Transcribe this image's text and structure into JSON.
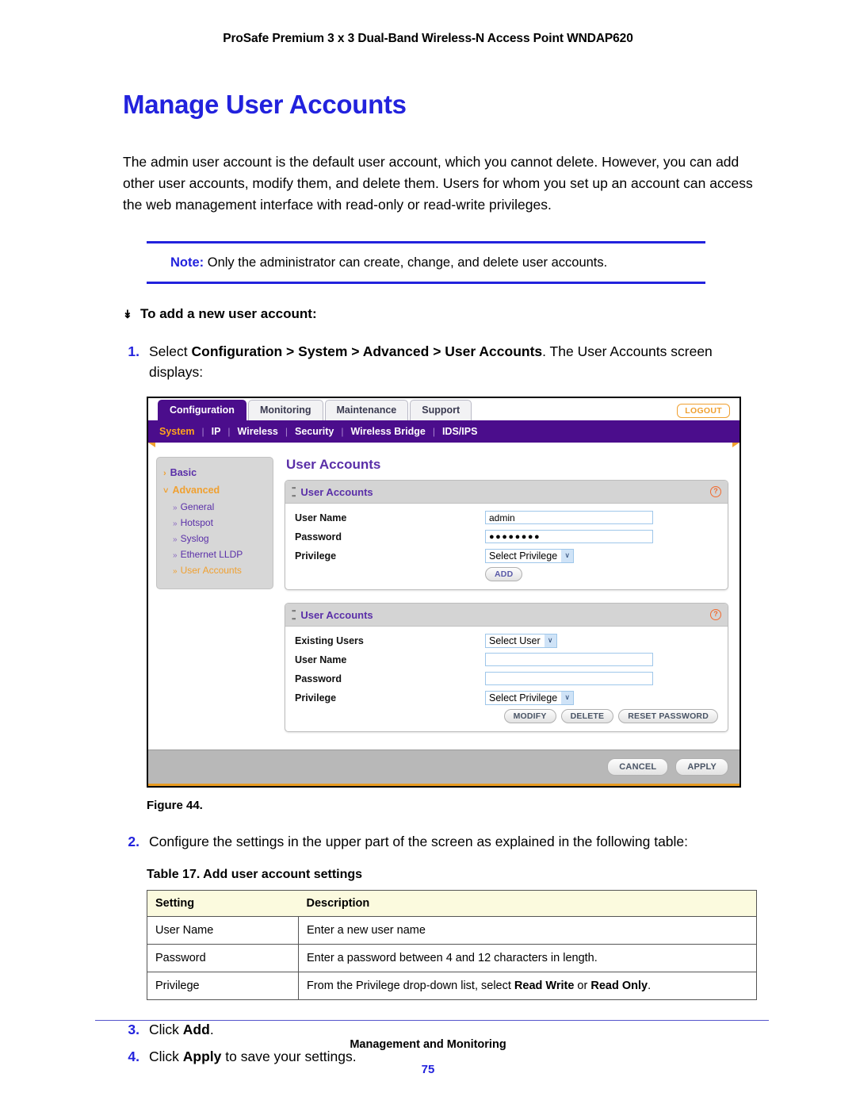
{
  "page_header": "ProSafe Premium 3 x 3 Dual-Band Wireless-N Access Point WNDAP620",
  "title": "Manage User Accounts",
  "intro": "The admin user account is the default user account, which you cannot delete. However, you can add other user accounts, modify them, and delete them. Users for whom you set up an account can access the web management interface with read-only or read-write privileges.",
  "note": {
    "label": "Note:",
    "text": " Only the administrator can create, change, and delete user accounts."
  },
  "procedure": {
    "marker": "↡",
    "heading": "To add a new user account:"
  },
  "steps": {
    "s1": {
      "num": "1.",
      "pre": "Select ",
      "bold": "Configuration > System > Advanced > User Accounts",
      "post": ". The User Accounts screen displays:"
    },
    "s2": {
      "num": "2.",
      "text": "Configure the settings in the upper part of the screen as explained in the following table:"
    },
    "s3": {
      "num": "3.",
      "pre": "Click ",
      "bold": "Add",
      "post": "."
    },
    "s4": {
      "num": "4.",
      "pre": "Click ",
      "bold": "Apply",
      "post": " to save your settings."
    }
  },
  "screenshot": {
    "tabs": [
      {
        "label": "Configuration",
        "active": true
      },
      {
        "label": "Monitoring",
        "active": false
      },
      {
        "label": "Maintenance",
        "active": false
      },
      {
        "label": "Support",
        "active": false
      }
    ],
    "logout_label": "LOGOUT",
    "subnav": [
      {
        "label": "System",
        "active": true
      },
      {
        "label": "IP",
        "active": false
      },
      {
        "label": "Wireless",
        "active": false
      },
      {
        "label": "Security",
        "active": false
      },
      {
        "label": "Wireless Bridge",
        "active": false
      },
      {
        "label": "IDS/IPS",
        "active": false
      }
    ],
    "sidebar": {
      "basic": {
        "label": "Basic",
        "arrow": "›"
      },
      "advanced": {
        "label": "Advanced",
        "arrow": "˅"
      },
      "sub_items": [
        {
          "label": "General",
          "active": false
        },
        {
          "label": "Hotspot",
          "active": false
        },
        {
          "label": "Syslog",
          "active": false
        },
        {
          "label": "Ethernet LLDP",
          "active": false
        },
        {
          "label": "User Accounts",
          "active": true
        }
      ],
      "sub_arrow": "»"
    },
    "page_title": "User Accounts",
    "help_glyph": "?",
    "panel_add": {
      "title": "User Accounts",
      "rows": {
        "user_name_label": "User Name",
        "user_name_value": "admin",
        "password_label": "Password",
        "password_value": "●●●●●●●●",
        "privilege_label": "Privilege",
        "privilege_value": "Select Privilege"
      },
      "add_button": "ADD"
    },
    "panel_modify": {
      "title": "User Accounts",
      "rows": {
        "existing_users_label": "Existing Users",
        "existing_users_value": "Select User",
        "user_name_label": "User Name",
        "user_name_value": "",
        "password_label": "Password",
        "password_value": "",
        "privilege_label": "Privilege",
        "privilege_value": "Select Privilege"
      },
      "buttons": [
        "MODIFY",
        "DELETE",
        "RESET PASSWORD"
      ]
    },
    "footer_buttons": [
      "CANCEL",
      "APPLY"
    ],
    "dropdown_arrow": "∨"
  },
  "figure_caption": "Figure 44.",
  "table": {
    "caption": "Table 17.  Add user account settings",
    "headers": [
      "Setting",
      "Description"
    ],
    "rows": [
      {
        "setting": "User Name",
        "desc_pre": "Enter a new user name",
        "desc_b1": "",
        "desc_mid": "",
        "desc_b2": "",
        "desc_post": ""
      },
      {
        "setting": "Password",
        "desc_pre": "Enter a password between 4 and 12 characters in length.",
        "desc_b1": "",
        "desc_mid": "",
        "desc_b2": "",
        "desc_post": ""
      },
      {
        "setting": "Privilege",
        "desc_pre": "From the Privilege drop-down list, select ",
        "desc_b1": "Read Write",
        "desc_mid": " or ",
        "desc_b2": "Read Only",
        "desc_post": "."
      }
    ]
  },
  "footer": {
    "title": "Management and Monitoring",
    "page": "75"
  },
  "colors": {
    "accent_blue": "#2222dd",
    "brand_purple": "#4b0d8c",
    "brand_orange": "#f0a030"
  }
}
